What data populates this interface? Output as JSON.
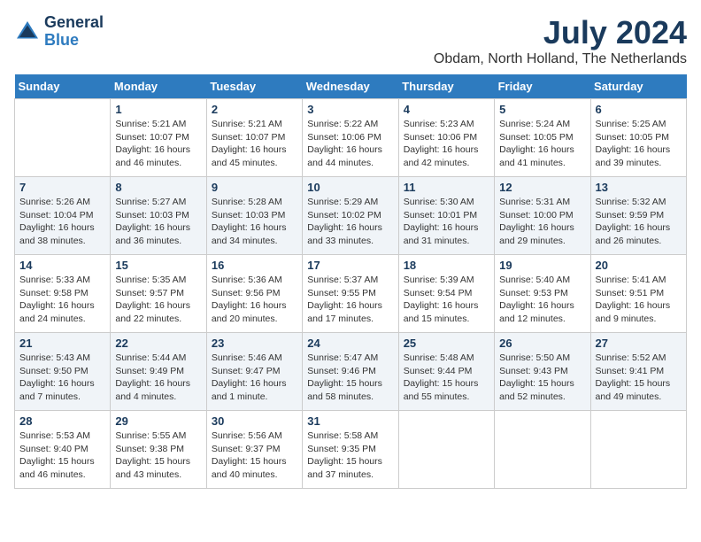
{
  "header": {
    "logo_general": "General",
    "logo_blue": "Blue",
    "title": "July 2024",
    "location": "Obdam, North Holland, The Netherlands"
  },
  "weekdays": [
    "Sunday",
    "Monday",
    "Tuesday",
    "Wednesday",
    "Thursday",
    "Friday",
    "Saturday"
  ],
  "weeks": [
    [
      {
        "day": "",
        "info": ""
      },
      {
        "day": "1",
        "info": "Sunrise: 5:21 AM\nSunset: 10:07 PM\nDaylight: 16 hours\nand 46 minutes."
      },
      {
        "day": "2",
        "info": "Sunrise: 5:21 AM\nSunset: 10:07 PM\nDaylight: 16 hours\nand 45 minutes."
      },
      {
        "day": "3",
        "info": "Sunrise: 5:22 AM\nSunset: 10:06 PM\nDaylight: 16 hours\nand 44 minutes."
      },
      {
        "day": "4",
        "info": "Sunrise: 5:23 AM\nSunset: 10:06 PM\nDaylight: 16 hours\nand 42 minutes."
      },
      {
        "day": "5",
        "info": "Sunrise: 5:24 AM\nSunset: 10:05 PM\nDaylight: 16 hours\nand 41 minutes."
      },
      {
        "day": "6",
        "info": "Sunrise: 5:25 AM\nSunset: 10:05 PM\nDaylight: 16 hours\nand 39 minutes."
      }
    ],
    [
      {
        "day": "7",
        "info": "Sunrise: 5:26 AM\nSunset: 10:04 PM\nDaylight: 16 hours\nand 38 minutes."
      },
      {
        "day": "8",
        "info": "Sunrise: 5:27 AM\nSunset: 10:03 PM\nDaylight: 16 hours\nand 36 minutes."
      },
      {
        "day": "9",
        "info": "Sunrise: 5:28 AM\nSunset: 10:03 PM\nDaylight: 16 hours\nand 34 minutes."
      },
      {
        "day": "10",
        "info": "Sunrise: 5:29 AM\nSunset: 10:02 PM\nDaylight: 16 hours\nand 33 minutes."
      },
      {
        "day": "11",
        "info": "Sunrise: 5:30 AM\nSunset: 10:01 PM\nDaylight: 16 hours\nand 31 minutes."
      },
      {
        "day": "12",
        "info": "Sunrise: 5:31 AM\nSunset: 10:00 PM\nDaylight: 16 hours\nand 29 minutes."
      },
      {
        "day": "13",
        "info": "Sunrise: 5:32 AM\nSunset: 9:59 PM\nDaylight: 16 hours\nand 26 minutes."
      }
    ],
    [
      {
        "day": "14",
        "info": "Sunrise: 5:33 AM\nSunset: 9:58 PM\nDaylight: 16 hours\nand 24 minutes."
      },
      {
        "day": "15",
        "info": "Sunrise: 5:35 AM\nSunset: 9:57 PM\nDaylight: 16 hours\nand 22 minutes."
      },
      {
        "day": "16",
        "info": "Sunrise: 5:36 AM\nSunset: 9:56 PM\nDaylight: 16 hours\nand 20 minutes."
      },
      {
        "day": "17",
        "info": "Sunrise: 5:37 AM\nSunset: 9:55 PM\nDaylight: 16 hours\nand 17 minutes."
      },
      {
        "day": "18",
        "info": "Sunrise: 5:39 AM\nSunset: 9:54 PM\nDaylight: 16 hours\nand 15 minutes."
      },
      {
        "day": "19",
        "info": "Sunrise: 5:40 AM\nSunset: 9:53 PM\nDaylight: 16 hours\nand 12 minutes."
      },
      {
        "day": "20",
        "info": "Sunrise: 5:41 AM\nSunset: 9:51 PM\nDaylight: 16 hours\nand 9 minutes."
      }
    ],
    [
      {
        "day": "21",
        "info": "Sunrise: 5:43 AM\nSunset: 9:50 PM\nDaylight: 16 hours\nand 7 minutes."
      },
      {
        "day": "22",
        "info": "Sunrise: 5:44 AM\nSunset: 9:49 PM\nDaylight: 16 hours\nand 4 minutes."
      },
      {
        "day": "23",
        "info": "Sunrise: 5:46 AM\nSunset: 9:47 PM\nDaylight: 16 hours\nand 1 minute."
      },
      {
        "day": "24",
        "info": "Sunrise: 5:47 AM\nSunset: 9:46 PM\nDaylight: 15 hours\nand 58 minutes."
      },
      {
        "day": "25",
        "info": "Sunrise: 5:48 AM\nSunset: 9:44 PM\nDaylight: 15 hours\nand 55 minutes."
      },
      {
        "day": "26",
        "info": "Sunrise: 5:50 AM\nSunset: 9:43 PM\nDaylight: 15 hours\nand 52 minutes."
      },
      {
        "day": "27",
        "info": "Sunrise: 5:52 AM\nSunset: 9:41 PM\nDaylight: 15 hours\nand 49 minutes."
      }
    ],
    [
      {
        "day": "28",
        "info": "Sunrise: 5:53 AM\nSunset: 9:40 PM\nDaylight: 15 hours\nand 46 minutes."
      },
      {
        "day": "29",
        "info": "Sunrise: 5:55 AM\nSunset: 9:38 PM\nDaylight: 15 hours\nand 43 minutes."
      },
      {
        "day": "30",
        "info": "Sunrise: 5:56 AM\nSunset: 9:37 PM\nDaylight: 15 hours\nand 40 minutes."
      },
      {
        "day": "31",
        "info": "Sunrise: 5:58 AM\nSunset: 9:35 PM\nDaylight: 15 hours\nand 37 minutes."
      },
      {
        "day": "",
        "info": ""
      },
      {
        "day": "",
        "info": ""
      },
      {
        "day": "",
        "info": ""
      }
    ]
  ]
}
